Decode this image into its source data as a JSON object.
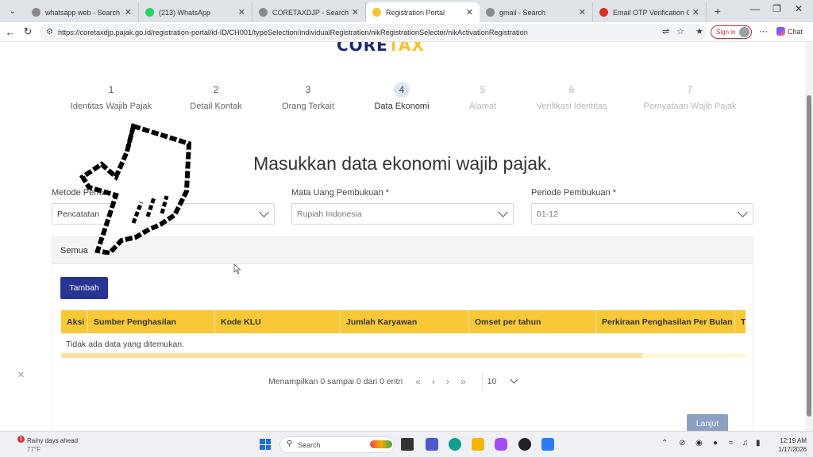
{
  "browser": {
    "tabs": [
      {
        "title": "whatsapp web - Search",
        "icon": "search-tab-icon",
        "color": "#8a8a8a"
      },
      {
        "title": "(213) WhatsApp",
        "icon": "whatsapp-icon",
        "color": "#25d366"
      },
      {
        "title": "CORETAXDJP - Search",
        "icon": "search-tab-icon",
        "color": "#8a8a8a"
      },
      {
        "title": "Registration Portal",
        "icon": "coretax-icon",
        "color": "#f5c32c",
        "active": true
      },
      {
        "title": "gmail - Search",
        "icon": "search-tab-icon",
        "color": "#8a8a8a"
      },
      {
        "title": "Email OTP Verification Code - ",
        "icon": "gmail-icon",
        "color": "#d93025"
      }
    ],
    "url": "https://coretaxdjp.pajak.go.id/registration-portal/id-ID/CH001/typeSelection/individualRegistration/nikRegistrationSelector/nikActivationRegistration",
    "sign_in": "Sign in",
    "chat": "Chat"
  },
  "logo": {
    "part1": "CORE",
    "part2": "TAX"
  },
  "steps": [
    {
      "num": "1",
      "label": "Identitas Wajib Pajak",
      "state": "done"
    },
    {
      "num": "2",
      "label": "Detail Kontak",
      "state": "done"
    },
    {
      "num": "3",
      "label": "Orang Terkait",
      "state": "done"
    },
    {
      "num": "4",
      "label": "Data Ekonomi",
      "state": "active"
    },
    {
      "num": "5",
      "label": "Alamat",
      "state": "future"
    },
    {
      "num": "6",
      "label": "Verifikasi Identitas",
      "state": "future"
    },
    {
      "num": "7",
      "label": "Pernyataan Wajib Pajak",
      "state": "future"
    }
  ],
  "heading": "Masukkan data ekonomi wajib pajak.",
  "fields": {
    "metode": {
      "label": "Metode Pemb",
      "value": "Pencatatan"
    },
    "mata_uang": {
      "label": "Mata Uang Pembukuan *",
      "value": "Rupiah Indonesia"
    },
    "periode": {
      "label": "Periode Pembukuan *",
      "value": "01-12"
    }
  },
  "card": {
    "title": "Semua",
    "add_button": "Tambah",
    "columns": [
      "Aksi",
      "Sumber Penghasilan",
      "Kode KLU",
      "Jumlah Karyawan",
      "Omset per tahun",
      "Perkiraan Penghasilan Per Bulan",
      "T"
    ],
    "empty": "Tidak ada data yang ditemukan.",
    "pager_text": "Menampilkan 0 sampai 0 dari 0 entri",
    "page_first": "«",
    "page_prev": "‹",
    "page_next": "›",
    "page_last": "»",
    "page_size": "10"
  },
  "next_button": "Lanjut",
  "taskbar": {
    "weather_badge": "1",
    "weather": "Rainy days ahead",
    "temp": "77°F",
    "search": "Search",
    "time": "12:19 AM",
    "date": "1/17/2026"
  }
}
